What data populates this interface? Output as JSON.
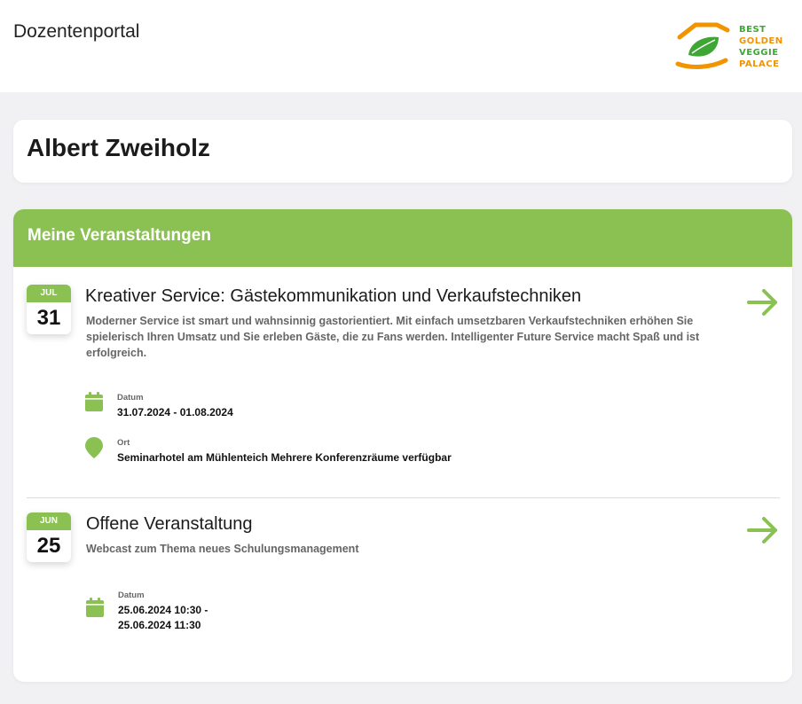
{
  "header": {
    "title": "Dozentenportal",
    "logo_lines": [
      "BEST",
      "GOLDEN",
      "VEGGIE",
      "PALACE"
    ]
  },
  "profile": {
    "name": "Albert Zweiholz"
  },
  "events_section": {
    "title": "Meine Veranstaltungen",
    "events": [
      {
        "month": "JUL",
        "day": "31",
        "title": "Kreativer Service: Gästekommunikation und Verkaufstechniken",
        "description": "Moderner Service ist smart und wahnsinnig gastorientiert. Mit einfach umsetzbaren Verkaufstechniken erhöhen Sie spielerisch Ihren Umsatz und Sie erleben Gäste, die zu Fans werden. Intelligenter Future Service macht Spaß und ist erfolgreich.",
        "date_label": "Datum",
        "date_value": "31.07.2024 - 01.08.2024",
        "location_label": "Ort",
        "location_value": "Seminarhotel am Mühlenteich Mehrere Konferenzräume verfügbar"
      },
      {
        "month": "JUN",
        "day": "25",
        "title": "Offene Veranstaltung",
        "description": "Webcast zum Thema neues Schulungsmanagement",
        "date_label": "Datum",
        "date_value_line1": "25.06.2024 10:30 -",
        "date_value_line2": "25.06.2024 11:30"
      }
    ]
  },
  "colors": {
    "accent": "#8bc152",
    "background": "#f1f1f4",
    "logo_green": "#3fa535",
    "logo_orange": "#f29400"
  },
  "icons": {
    "arrow": "arrow-right-icon",
    "calendar": "calendar-icon",
    "location": "map-pin-icon"
  }
}
